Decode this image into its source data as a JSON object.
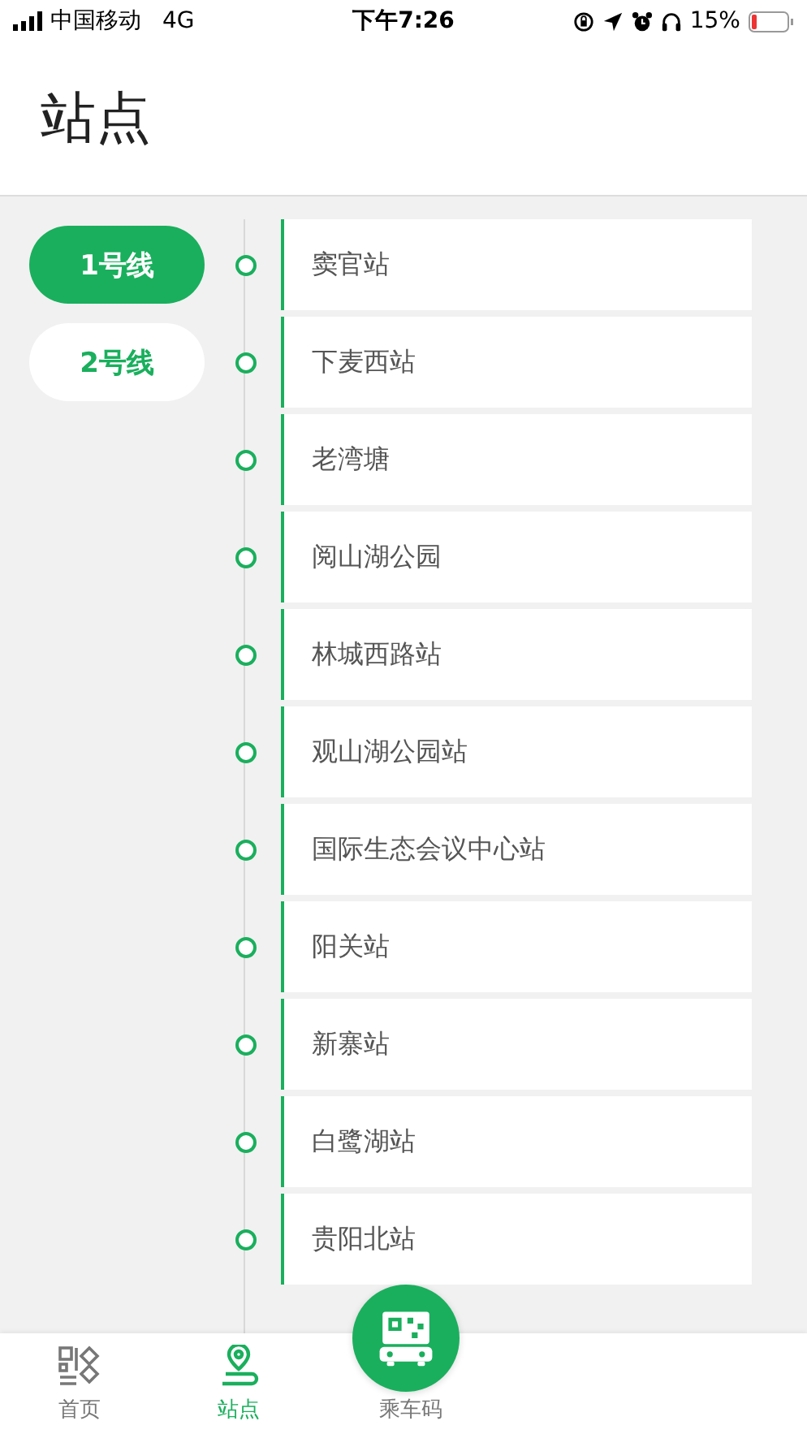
{
  "status_bar": {
    "carrier": "中国移动",
    "network": "4G",
    "time": "下午7:26",
    "battery": "15%"
  },
  "title": "站点",
  "lines": [
    {
      "label": "1号线",
      "selected": true
    },
    {
      "label": "2号线",
      "selected": false
    }
  ],
  "stations": [
    "窦官站",
    "下麦西站",
    "老湾塘",
    "阅山湖公园",
    "林城西路站",
    "观山湖公园站",
    "国际生态会议中心站",
    "阳关站",
    "新寨站",
    "白鹭湖站",
    "贵阳北站"
  ],
  "tab_bar": [
    {
      "label": "首页",
      "kind": "home",
      "selected": false
    },
    {
      "label": "站点",
      "kind": "stations",
      "selected": true
    },
    {
      "label": "乘车码",
      "kind": "code",
      "selected": false
    }
  ]
}
